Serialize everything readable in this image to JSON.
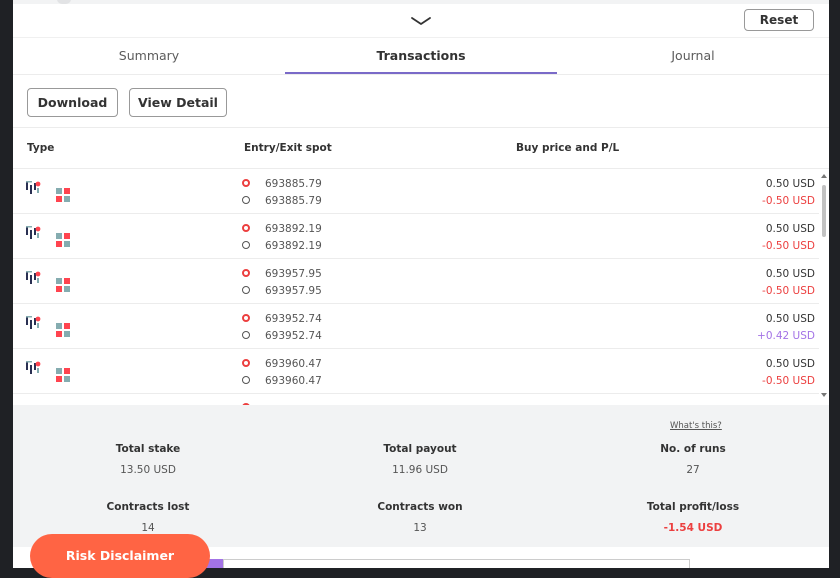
{
  "header": {
    "reset_label": "Reset"
  },
  "tabs": [
    {
      "label": "Summary"
    },
    {
      "label": "Transactions"
    },
    {
      "label": "Journal"
    }
  ],
  "actions": {
    "download_label": "Download",
    "view_detail_label": "View Detail"
  },
  "table": {
    "headers": {
      "type": "Type",
      "spot": "Entry/Exit spot",
      "buy": "Buy price and P/L"
    },
    "rows": [
      {
        "entry": "693885.79",
        "exit": "693885.79",
        "buy": "0.50 USD",
        "pl": "-0.50 USD",
        "pl_status": "loss"
      },
      {
        "entry": "693892.19",
        "exit": "693892.19",
        "buy": "0.50 USD",
        "pl": "-0.50 USD",
        "pl_status": "loss"
      },
      {
        "entry": "693957.95",
        "exit": "693957.95",
        "buy": "0.50 USD",
        "pl": "-0.50 USD",
        "pl_status": "loss"
      },
      {
        "entry": "693952.74",
        "exit": "693952.74",
        "buy": "0.50 USD",
        "pl": "+0.42 USD",
        "pl_status": "profit"
      },
      {
        "entry": "693960.47",
        "exit": "693960.47",
        "buy": "0.50 USD",
        "pl": "-0.50 USD",
        "pl_status": "loss"
      }
    ]
  },
  "summary": {
    "whats_this": "What's this?",
    "total_stake_label": "Total stake",
    "total_stake": "13.50 USD",
    "total_payout_label": "Total payout",
    "total_payout": "11.96 USD",
    "runs_label": "No. of runs",
    "runs": "27",
    "contracts_lost_label": "Contracts lost",
    "contracts_lost": "14",
    "contracts_won_label": "Contracts won",
    "contracts_won": "13",
    "profit_loss_label": "Total profit/loss",
    "profit_loss": "-1.54 USD"
  },
  "risk_disclaimer": "Risk Disclaimer",
  "colors": {
    "loss": "#ec3f3f",
    "profit": "#a373e6",
    "risk_button": "#ff6444",
    "tab_underline": "#7a6ac8"
  },
  "icons": {
    "type": "trade-type-chart-icon",
    "contract": "contract-grid-icon",
    "entry": "entry-spot-red-circle-icon",
    "exit": "exit-spot-grey-circle-icon"
  }
}
